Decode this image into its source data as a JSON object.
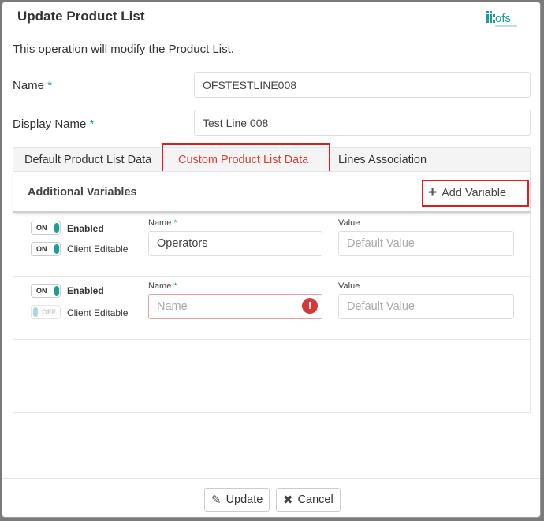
{
  "modal": {
    "title": "Update Product List",
    "logo_text": "ofs",
    "intro": "This operation will modify the Product List."
  },
  "form": {
    "name_label": "Name",
    "name_value": "OFSTESTLINE008",
    "display_name_label": "Display Name",
    "display_name_value": "Test Line 008",
    "required_mark": "*"
  },
  "tabs": [
    {
      "label": "Default Product List Data",
      "active": false
    },
    {
      "label": "Custom Product List Data",
      "active": true
    },
    {
      "label": "Lines Association",
      "active": false
    }
  ],
  "panel": {
    "title": "Additional Variables",
    "add_variable_label": "Add Variable",
    "name_col_label": "Name",
    "value_col_label": "Value",
    "required_mark": "*"
  },
  "variables": [
    {
      "enabled": {
        "state": "ON",
        "label": "Enabled"
      },
      "client_editable": {
        "state": "ON",
        "label": "Client Editable"
      },
      "name_value": "Operators",
      "name_placeholder": "Name",
      "value_placeholder": "Default Value",
      "error": false
    },
    {
      "enabled": {
        "state": "ON",
        "label": "Enabled"
      },
      "client_editable": {
        "state": "OFF",
        "label": "Client Editable"
      },
      "name_value": "",
      "name_placeholder": "Name",
      "value_placeholder": "Default Value",
      "error": true,
      "error_icon": "!"
    }
  ],
  "footer": {
    "update_label": "Update",
    "cancel_label": "Cancel"
  },
  "colors": {
    "accent": "#1a9e96",
    "highlight": "#e01c1c",
    "error": "#d23a3a"
  },
  "icons": {
    "update": "pencil-icon",
    "cancel": "close-icon",
    "add": "plus-icon",
    "error": "exclamation-icon"
  }
}
